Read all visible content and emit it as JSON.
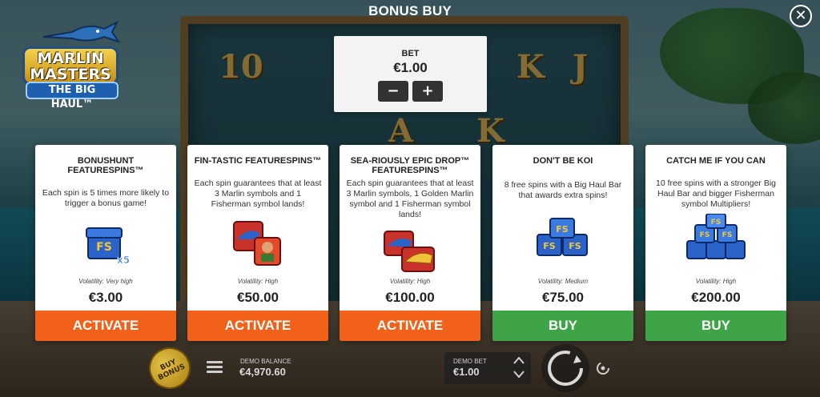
{
  "header": {
    "title": "BONUS BUY",
    "close_icon": "close-icon"
  },
  "logo": {
    "line1": "MARLIN MASTERS",
    "line2": "THE BIG HAUL™"
  },
  "bet_panel": {
    "label": "BET",
    "value": "€1.00",
    "decrease": "−",
    "increase": "+"
  },
  "cards": [
    {
      "title": "BONUSHUNT FEATURESPINS™",
      "description": "Each spin is 5 times more likely to trigger a bonus game!",
      "icon": "fs-chest-x5-icon",
      "multiplier": "x5",
      "volatility": "Volatility: Very high",
      "price": "€3.00",
      "button": "ACTIVATE",
      "button_color": "#f2611a"
    },
    {
      "title": "FIN-TASTIC FEATURESPINS™",
      "description": "Each spin guarantees that at least 3 Marlin symbols and 1 Fisherman symbol lands!",
      "icon": "marlin-fisherman-icon",
      "volatility": "Volatility: High",
      "price": "€50.00",
      "button": "ACTIVATE",
      "button_color": "#f2611a"
    },
    {
      "title": "SEA-RIOUSLY EPIC DROP™ FEATURESPINS™",
      "description": "Each spin guarantees that at least 3 Marlin symbols, 1 Golden Marlin symbol and 1 Fisherman symbol lands!",
      "icon": "golden-marlin-icon",
      "volatility": "Volatility: High",
      "price": "€100.00",
      "button": "ACTIVATE",
      "button_color": "#f2611a"
    },
    {
      "title": "DON'T BE KOI",
      "description": "8 free spins with a Big Haul Bar that awards extra spins!",
      "icon": "fs-chests-icon",
      "volatility": "Volatility: Medium",
      "price": "€75.00",
      "button": "BUY",
      "button_color": "#3fa447"
    },
    {
      "title": "CATCH ME IF YOU CAN",
      "description": "10 free spins with a stronger Big Haul Bar and bigger Fisherman symbol Multipliers!",
      "icon": "fs-chests-stack-icon",
      "volatility": "Volatility: High",
      "price": "€200.00",
      "button": "BUY",
      "button_color": "#3fa447"
    }
  ],
  "bottom_bar": {
    "buy_bonus": "BUY BONUS",
    "demo_balance_label": "DEMO BALANCE",
    "demo_balance_value": "€4,970.60",
    "demo_bet_label": "DEMO BET",
    "demo_bet_value": "€1.00"
  },
  "reel_symbols": [
    "10",
    "K",
    "J",
    "A",
    "K"
  ]
}
